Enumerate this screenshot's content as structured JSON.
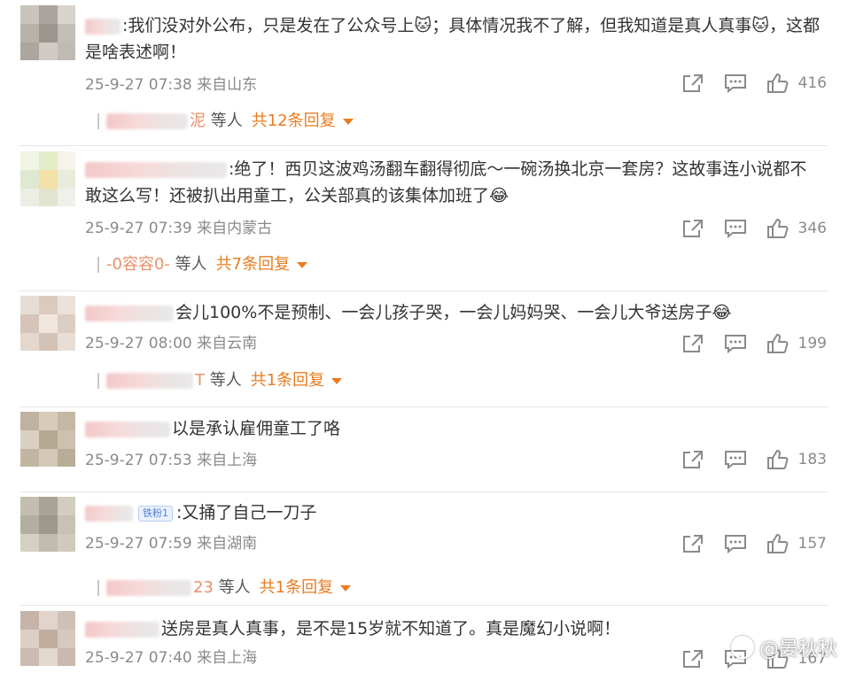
{
  "comments": [
    {
      "name_suffix": "",
      "text": ":我们没对外公布，只是发在了公众号上🐱；具体情况我不了解，但我知道是真人真事🐱，这都是啥表述啊！",
      "time": "25-9-27 07:38",
      "location": "来自山东",
      "likes": "416",
      "reply_who_suffix": "泥",
      "reply_etc": "等人",
      "reply_more": "共12条回复"
    },
    {
      "name_suffix": "",
      "text": ":绝了！西贝这波鸡汤翻车翻得彻底～一碗汤换北京一套房？这故事连小说都不敢这么写！还被扒出用童工，公关部真的该集体加班了😂",
      "time": "25-9-27 07:39",
      "location": "来自内蒙古",
      "likes": "346",
      "reply_who_suffix": "-0容容0-",
      "reply_etc": "等人",
      "reply_more": "共7条回复"
    },
    {
      "name_suffix": "",
      "text": "会儿100%不是预制、一会儿孩子哭，一会儿妈妈哭、一会儿大爷送房子😂",
      "time": "25-9-27 08:00",
      "location": "来自云南",
      "likes": "199",
      "reply_who_suffix": "T",
      "reply_etc": "等人",
      "reply_more": "共1条回复"
    },
    {
      "name_suffix": "",
      "text": "以是承认雇佣童工了咯",
      "time": "25-9-27 07:53",
      "location": "来自上海",
      "likes": "183"
    },
    {
      "name_suffix": "",
      "badge": "铁粉1",
      "text": ":又捅了自己一刀子",
      "time": "25-9-27 07:59",
      "location": "来自湖南",
      "likes": "157",
      "reply_who_suffix": "23",
      "reply_etc": "等人",
      "reply_more": "共1条回复"
    },
    {
      "name_suffix": "",
      "text": "送房是真人真事，是不是15岁就不知道了。真是魔幻小说啊！",
      "time": "25-9-27 07:40",
      "location": "来自上海",
      "likes": "167"
    }
  ],
  "watermark": "@晏秋秋",
  "icons": {
    "share": "share-icon",
    "comment": "comment-icon",
    "like": "thumbs-up-icon"
  },
  "colors": {
    "reply_more": "#ea7c20",
    "meta": "#8a8a8a",
    "text": "#333333"
  }
}
